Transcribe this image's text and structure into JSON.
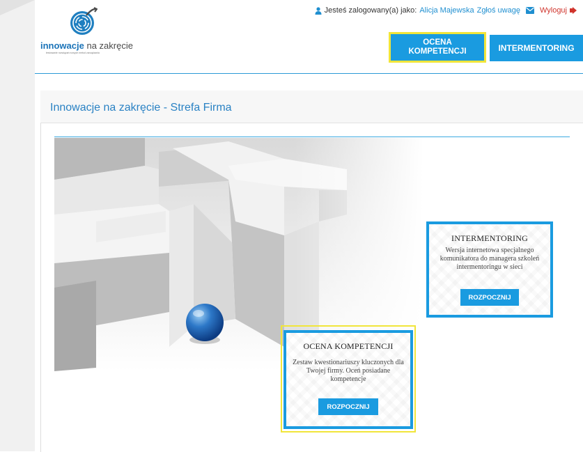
{
  "header": {
    "logo": {
      "brand_bold": "innowacje",
      "brand_light": "na zakręcie",
      "tagline": "testowanie rozwiązań nowych metod zarządzania"
    },
    "user": {
      "logged_in_label": "Jesteś zalogowany(a) jako:",
      "user_name": "Alicja Majewska",
      "report_link": "Zgłoś uwagę",
      "logout_link": "Wyloguj"
    },
    "nav": {
      "ocena_line1": "OCENA",
      "ocena_line2": "KOMPETENCJI",
      "intermentoring": "INTERMENTORING"
    }
  },
  "panel": {
    "title": "Innowacje na zakręcie - Strefa Firma"
  },
  "cards": {
    "intermentoring": {
      "title": "INTERMENTORING",
      "description": "Wersja internetowa specjalnego komunikatora do managera szkoleń intermentoringu w sieci",
      "button": "ROZPOCZNIJ"
    },
    "ocena": {
      "title": "OCENA KOMPETENCJI",
      "description": "Zestaw kwestionariuszy kluczonych dla Twojej firmy. Oceń posiadane kompetencje",
      "button": "ROZPOCZNIJ"
    }
  },
  "colors": {
    "accent": "#1a9be0",
    "highlight": "#f1e53a",
    "logout": "#d0342c"
  }
}
